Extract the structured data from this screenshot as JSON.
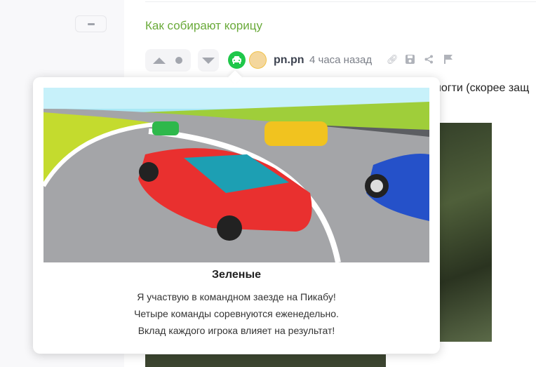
{
  "sidebar": {
    "collapse_label": "−"
  },
  "post": {
    "title": "Как собирают корицу",
    "author": "pn.pn",
    "time": "4 часа назад",
    "body_snippet": "ногти (скорее защ",
    "icons": [
      "arrow-up-icon",
      "dot-icon",
      "arrow-down-icon",
      "car-badge-icon",
      "avatar",
      "link-icon",
      "save-icon",
      "share-icon",
      "flag-icon"
    ]
  },
  "popup": {
    "team": "Зеленые",
    "lines": [
      "Я участвую в командном заезде на Пикабу!",
      "Четыре команды соревнуются еженедельно.",
      "Вклад каждого игрока влияет на результат!"
    ]
  },
  "colors": {
    "title": "#6aaa3a",
    "badge": "#1fc74a"
  }
}
